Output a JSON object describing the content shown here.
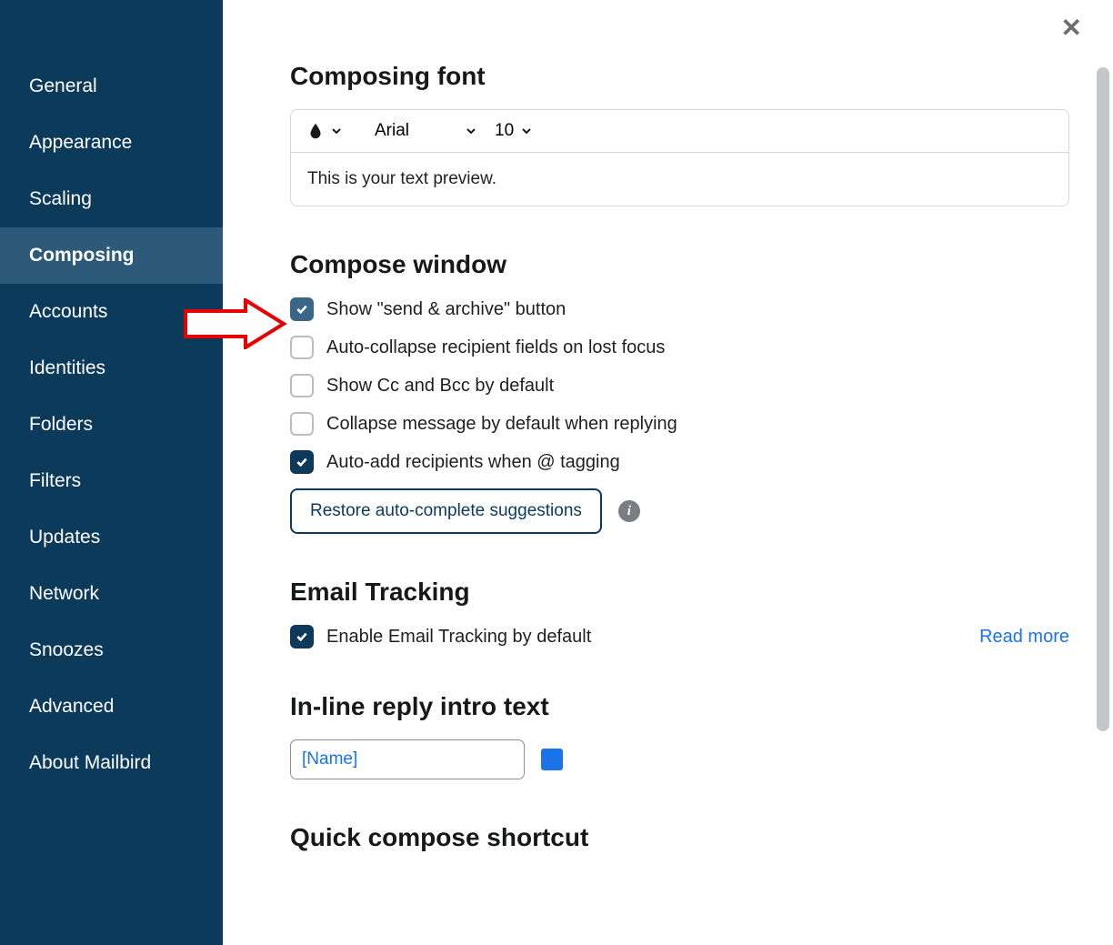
{
  "sidebar": {
    "items": [
      {
        "label": "General",
        "active": false
      },
      {
        "label": "Appearance",
        "active": false
      },
      {
        "label": "Scaling",
        "active": false
      },
      {
        "label": "Composing",
        "active": true
      },
      {
        "label": "Accounts",
        "active": false
      },
      {
        "label": "Identities",
        "active": false
      },
      {
        "label": "Folders",
        "active": false
      },
      {
        "label": "Filters",
        "active": false
      },
      {
        "label": "Updates",
        "active": false
      },
      {
        "label": "Network",
        "active": false
      },
      {
        "label": "Snoozes",
        "active": false
      },
      {
        "label": "Advanced",
        "active": false
      },
      {
        "label": "About Mailbird",
        "active": false
      }
    ]
  },
  "sections": {
    "composing_font": {
      "title": "Composing font",
      "font_name": "Arial",
      "font_size": "10",
      "preview": "This is your text preview."
    },
    "compose_window": {
      "title": "Compose window",
      "options": [
        {
          "label": "Show \"send & archive\" button",
          "checked": true,
          "highlighted": true
        },
        {
          "label": "Auto-collapse recipient fields on lost focus",
          "checked": false
        },
        {
          "label": "Show Cc and Bcc by default",
          "checked": false
        },
        {
          "label": "Collapse message by default when replying",
          "checked": false
        },
        {
          "label": "Auto-add recipients when @ tagging",
          "checked": true
        }
      ],
      "restore_btn": "Restore auto-complete suggestions"
    },
    "email_tracking": {
      "title": "Email Tracking",
      "option_label": "Enable Email Tracking by default",
      "option_checked": true,
      "read_more": "Read more"
    },
    "inline_reply": {
      "title": "In-line reply intro text",
      "value": "[Name]",
      "color": "#1a73e8"
    },
    "quick_compose": {
      "title": "Quick compose shortcut"
    }
  },
  "icons": {
    "info": "i",
    "close": "✕"
  }
}
